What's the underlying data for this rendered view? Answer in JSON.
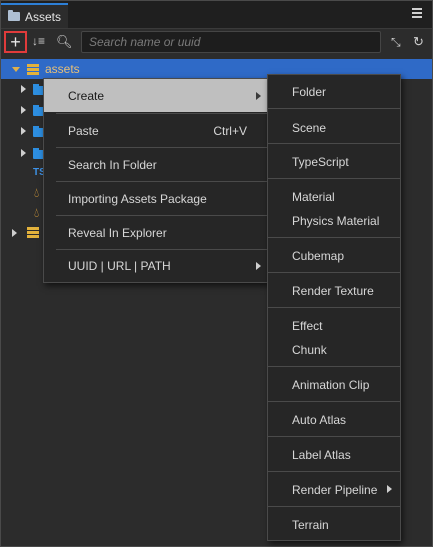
{
  "panel": {
    "tab_title": "Assets",
    "search_placeholder": "Search name or uuid"
  },
  "tree": {
    "root_label": "assets",
    "ts_label": "TS"
  },
  "context_menu": {
    "items": [
      {
        "label": "Create",
        "shortcut": ""
      },
      {
        "label": "Paste",
        "shortcut": "Ctrl+V"
      },
      {
        "label": "Search In Folder",
        "shortcut": ""
      },
      {
        "label": "Importing Assets Package",
        "shortcut": ""
      },
      {
        "label": "Reveal In Explorer",
        "shortcut": ""
      },
      {
        "label": "UUID | URL | PATH",
        "shortcut": ""
      }
    ]
  },
  "create_submenu": {
    "items": [
      "Folder",
      "Scene",
      "TypeScript",
      "Material",
      "Physics Material",
      "Cubemap",
      "Render Texture",
      "Effect",
      "Chunk",
      "Animation Clip",
      "Auto Atlas",
      "Label Atlas",
      "Render Pipeline",
      "Terrain"
    ]
  },
  "colors": {
    "accent": "#2f6ac7",
    "highlight": "#e03b3b",
    "menu_hover": "#bfbfbf"
  }
}
